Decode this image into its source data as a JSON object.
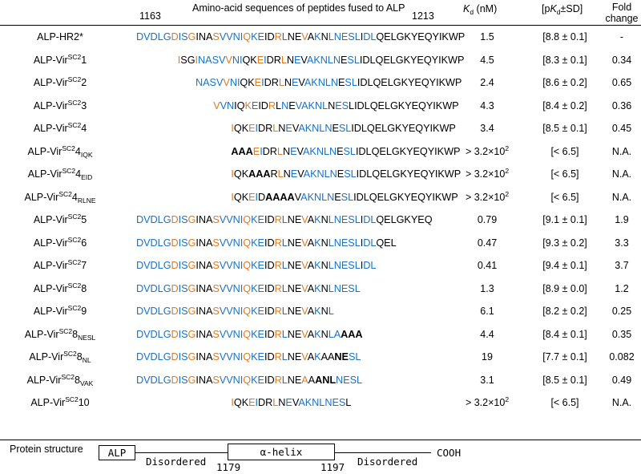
{
  "header": {
    "start_num": "1163",
    "end_num": "1213",
    "seq_title": "Amino-acid sequences of peptides fused to ALP",
    "kd_italic": "K",
    "kd_sub": "d",
    "kd_unit": " (nM)",
    "pk_open": "[p",
    "pk_italic": "K",
    "pk_sub": "d",
    "pk_close": "±SD]",
    "fold_line1": "Fold",
    "fold_line2": "change"
  },
  "colors": {
    "blue": "#1a72c9",
    "orange": "#e07a1f",
    "black": "#000000"
  },
  "rows": [
    {
      "prefix": "ALP-HR2*",
      "sup": "",
      "sub": "",
      "pad": 0,
      "seq": "bbbbbobbokkkobbbbobbkkobkkokbkbbbbbkbbkkkkkkkkkkkkkkk",
      "seq_text": "DVDLGDISGINASVVNIQKEIDRLNEVAKNLNESLIDLQELGKYEQYIKWP",
      "kd": "1.5",
      "kd_exp": "",
      "pk": "[8.8 ± 0.1]",
      "fc": "-"
    },
    {
      "prefix": "ALP-Vir",
      "sup": "SC2",
      "sub": "1",
      "pad": 7,
      "seq": "okkobbbbobbkkobkkokbkbbbbbkbbkkkkkkkkkkkkkkk",
      "seq_text": "ISGINASVVNIQKEIDRLNEVAKNLNESLIDLQELGKYEQYIKWP",
      "kd": "4.5",
      "kd_exp": "",
      "pk": "[8.3 ± 0.1]",
      "fc": "0.34"
    },
    {
      "prefix": "ALP-Vir",
      "sup": "SC2",
      "sub": "2",
      "pad": 10,
      "seq": "bbbbobbkkobkkokbkbbbbbkbbkkkkkkkkkkkkkkk",
      "seq_text": "NASVVNIQKEIDRLNEVAKNLNESLIDLQELGKYEQYIKWP",
      "kd": "2.4",
      "kd_exp": "",
      "pk": "[8.6 ± 0.2]",
      "fc": "0.65"
    },
    {
      "prefix": "ALP-Vir",
      "sup": "SC2",
      "sub": "3",
      "pad": 13,
      "seq": "obbkkobkkokbkbbbbbkbbkkkkkkkkkkkkkkk",
      "seq_text": "VVNIQKEIDRLNEVAKNLNESLIDLQELGKYEQYIKWP",
      "kd": "4.3",
      "kd_exp": "",
      "pk": "[8.4 ± 0.2]",
      "fc": "0.36"
    },
    {
      "prefix": "ALP-Vir",
      "sup": "SC2",
      "sub": "4",
      "pad": 16,
      "seq": "okkobkkokbkbbbbbkbbkkkkkkkkkkkkkkk",
      "seq_text": "IQKEIDRLNEVAKNLNESLIDLQELGKYEQYIKWP",
      "kd": "3.4",
      "kd_exp": "",
      "pk": "[8.5 ± 0.1]",
      "fc": "0.45"
    },
    {
      "prefix": "ALP-Vir",
      "sup": "SC2",
      "sub": "4IQK",
      "pad": 16,
      "seq": "xxxobkkokbkbbbbbkbbkkkkkkkkkkkkkkk",
      "seq_text": "AAAEIDRLNEVAKNLNESLIDLQELGKYEQYIKWP",
      "kd": "> 3.2×10",
      "kd_exp": "2",
      "pk": "[< 6.5]",
      "fc": "N.A."
    },
    {
      "prefix": "ALP-Vir",
      "sup": "SC2",
      "sub": "4EID",
      "pad": 16,
      "seq": "okkxxxkokbkbbbbbkbbkkkkkkkkkkkkkkk",
      "seq_text": "IQKAAARLNEVAKNLNESLIDLQELGKYEQYIKWP",
      "kd": "> 3.2×10",
      "kd_exp": "2",
      "pk": "[< 6.5]",
      "fc": "N.A."
    },
    {
      "prefix": "ALP-Vir",
      "sup": "SC2",
      "sub": "4RLNE",
      "pad": 16,
      "seq": "okkobkxxxxkbbbbbkbbkkkkkkkkkkkkkkk",
      "seq_text": "IQKEIDAAAAVAKNLNESLIDLQELGKYEQYIKWP",
      "kd": "> 3.2×10",
      "kd_exp": "2",
      "pk": "[< 6.5]",
      "fc": "N.A."
    },
    {
      "prefix": "ALP-Vir",
      "sup": "SC2",
      "sub": "5",
      "pad": 0,
      "seq": "bbbbbobbokkkobbbbobbkkobkkokbkbbbbbkbbkkkkkkkkk",
      "seq_text": "DVDLGDISGINASVVNIQKEIDRLNEVAKNLNESLIDLQELGKYEQ",
      "kd": "0.79",
      "kd_exp": "",
      "pk": "[9.1 ± 0.1]",
      "fc": "1.9"
    },
    {
      "prefix": "ALP-Vir",
      "sup": "SC2",
      "sub": "6",
      "pad": 0,
      "seq": "bbbbbobbokkkobbbbobbkkobkkokbkbbbbbkbbkkkk",
      "seq_text": "DVDLGDISGINASVVNIQKEIDRLNEVAKNLNESLIDLQEL",
      "kd": "0.47",
      "kd_exp": "",
      "pk": "[9.3 ± 0.2]",
      "fc": "3.3"
    },
    {
      "prefix": "ALP-Vir",
      "sup": "SC2",
      "sub": "7",
      "pad": 0,
      "seq": "bbbbbobbokkkobbbbobbkkobkkokbkbbbbbkbbkkko",
      "seq_text": "DVDLGDISGINASVVNIQKEIDRLNEVAKNLNESLIDL",
      "kd": "0.41",
      "kd_exp": "",
      "pk": "[9.4 ± 0.1]",
      "fc": "3.7"
    },
    {
      "prefix": "ALP-Vir",
      "sup": "SC2",
      "sub": "8",
      "pad": 0,
      "seq": "bbbbbobbokkkobbbbobbkkobkkokbkbbbbbb",
      "seq_text": "DVDLGDISGINASVVNIQKEIDRLNEVAKNLNESL",
      "kd": "1.3",
      "kd_exp": "",
      "pk": "[8.9 ± 0.0]",
      "fc": "1.2"
    },
    {
      "prefix": "ALP-Vir",
      "sup": "SC2",
      "sub": "9",
      "pad": 0,
      "seq": "bbbbbobbokkkobbbbobbkkobkkokbkbb",
      "seq_text": "DVDLGDISGINASVVNIQKEIDRLNEVAKNL",
      "kd": "6.1",
      "kd_exp": "",
      "pk": "[8.2 ± 0.2]",
      "fc": "0.25"
    },
    {
      "prefix": "ALP-Vir",
      "sup": "SC2",
      "sub": "8NESL",
      "pad": 0,
      "seq": "bbbbbobbokkkobbbbobbkkobkkokbkbbxxxx",
      "seq_text": "DVDLGDISGINASVVNIQKEIDRLNEVAKNLAAAA",
      "kd": "4.4",
      "kd_exp": "",
      "pk": "[8.4 ± 0.1]",
      "fc": "0.35"
    },
    {
      "prefix": "ALP-Vir",
      "sup": "SC2",
      "sub": "8NL",
      "pad": 0,
      "seq": "bbbbbobbokkkobbbbobbkkobkkokbkkxxbbbb",
      "seq_text": "DVDLGDISGINASVVNIQKEIDRLNEVAKAANESL",
      "kd": "19",
      "kd_exp": "",
      "pk": "[7.7 ± 0.1]",
      "fc": "0.082"
    },
    {
      "prefix": "ALP-Vir",
      "sup": "SC2",
      "sub": "8VAK",
      "pad": 0,
      "seq": "bbbbbobbokkkobbbbobbkkobkkokxxxbbbbbb",
      "seq_text": "DVDLGDISGINASVVNIQKEIDRLNEAAANLNESL",
      "kd": "3.1",
      "kd_exp": "",
      "pk": "[8.5 ± 0.1]",
      "fc": "0.49"
    },
    {
      "prefix": "ALP-Vir",
      "sup": "SC2",
      "sub": "10",
      "pad": 16,
      "seq": "okkobkkokbkbbbbbbb",
      "seq_text": "IQKEIDRLNEVAKNLNESL",
      "kd": "> 3.2×10",
      "kd_exp": "2",
      "pk": "[< 6.5]",
      "fc": "N.A."
    }
  ],
  "structure": {
    "label": "Protein structure",
    "alp": "ALP",
    "helix": "α-helix",
    "disordered1": "Disordered",
    "disordered2": "Disordered",
    "cooh": "COOH",
    "num_start": "1179",
    "num_end": "1197"
  }
}
